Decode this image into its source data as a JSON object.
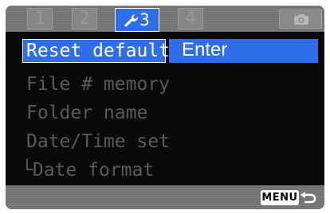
{
  "tabs": [
    {
      "label": "1",
      "state": "inactive"
    },
    {
      "label": "2",
      "state": "inactive"
    },
    {
      "label": "3",
      "state": "active",
      "icon": "wrench-icon"
    },
    {
      "label": "4",
      "state": "inactive"
    }
  ],
  "camera_tab": {
    "icon": "camera-icon"
  },
  "menu": {
    "selected": {
      "label": "Reset default",
      "value": "Enter"
    },
    "items": [
      {
        "label": "File # memory"
      },
      {
        "label": "Folder name"
      },
      {
        "label": "Date/Time set"
      },
      {
        "label": "Date format",
        "prefix": "└"
      }
    ]
  },
  "footer": {
    "menu_label": "MENU",
    "back_icon": "return-arrow-icon"
  },
  "colors": {
    "highlight": "#2f6ee8",
    "bar_gray": "#7a7a7a",
    "dim_text": "#5a5a5a",
    "background": "#0a0a0a"
  }
}
